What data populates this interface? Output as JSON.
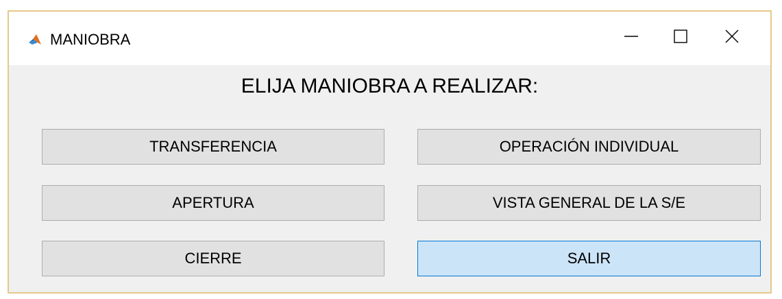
{
  "window": {
    "title": "MANIOBRA",
    "app_icon": "matlab-icon",
    "controls": {
      "minimize": "minimize-icon",
      "maximize": "maximize-icon",
      "close": "close-icon"
    },
    "border_color": "#e3c98a"
  },
  "main": {
    "heading": "ELIJA MANIOBRA A REALIZAR:",
    "buttons": {
      "transferencia": "TRANSFERENCIA",
      "operacion_individual": "OPERACIÓN INDIVIDUAL",
      "apertura": "APERTURA",
      "vista_general": "VISTA GENERAL DE LA S/E",
      "cierre": "CIERRE",
      "salir": "SALIR"
    }
  },
  "colors": {
    "button_face": "#e1e1e1",
    "default_button_face": "#cce4f7",
    "default_button_border": "#0078d7",
    "client_background": "#f0f0f0"
  }
}
